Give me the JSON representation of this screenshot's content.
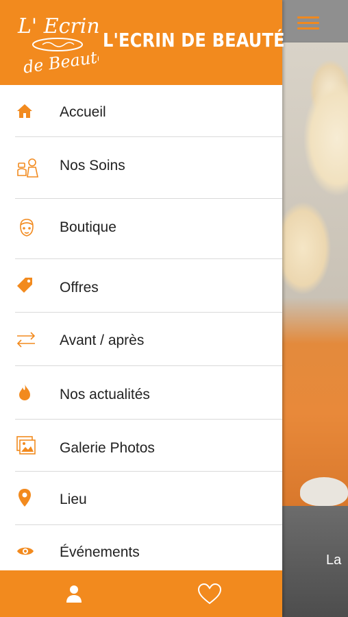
{
  "header": {
    "brand": "L'ECRIN DE BEAUTÉ"
  },
  "logo": {
    "line1": "L' Ecrin",
    "line2": "de Beauté"
  },
  "menu": {
    "items": [
      {
        "label": "Accueil",
        "icon": "home-icon"
      },
      {
        "label": "Nos Soins",
        "icon": "care-icon"
      },
      {
        "label": "Boutique",
        "icon": "face-icon"
      },
      {
        "label": "Offres",
        "icon": "tag-icon"
      },
      {
        "label": "Avant / après",
        "icon": "swap-arrows-icon"
      },
      {
        "label": "Nos actualités",
        "icon": "flame-icon"
      },
      {
        "label": "Galerie Photos",
        "icon": "gallery-icon"
      },
      {
        "label": "Lieu",
        "icon": "location-pin-icon"
      },
      {
        "label": "Événements",
        "icon": "eye-icon"
      }
    ]
  },
  "background": {
    "caption": "La"
  },
  "footer": {
    "left_icon": "user-icon",
    "right_icon": "heart-icon"
  },
  "colors": {
    "accent": "#f28a1e",
    "text": "#222222",
    "divider": "#d9d9d9"
  }
}
